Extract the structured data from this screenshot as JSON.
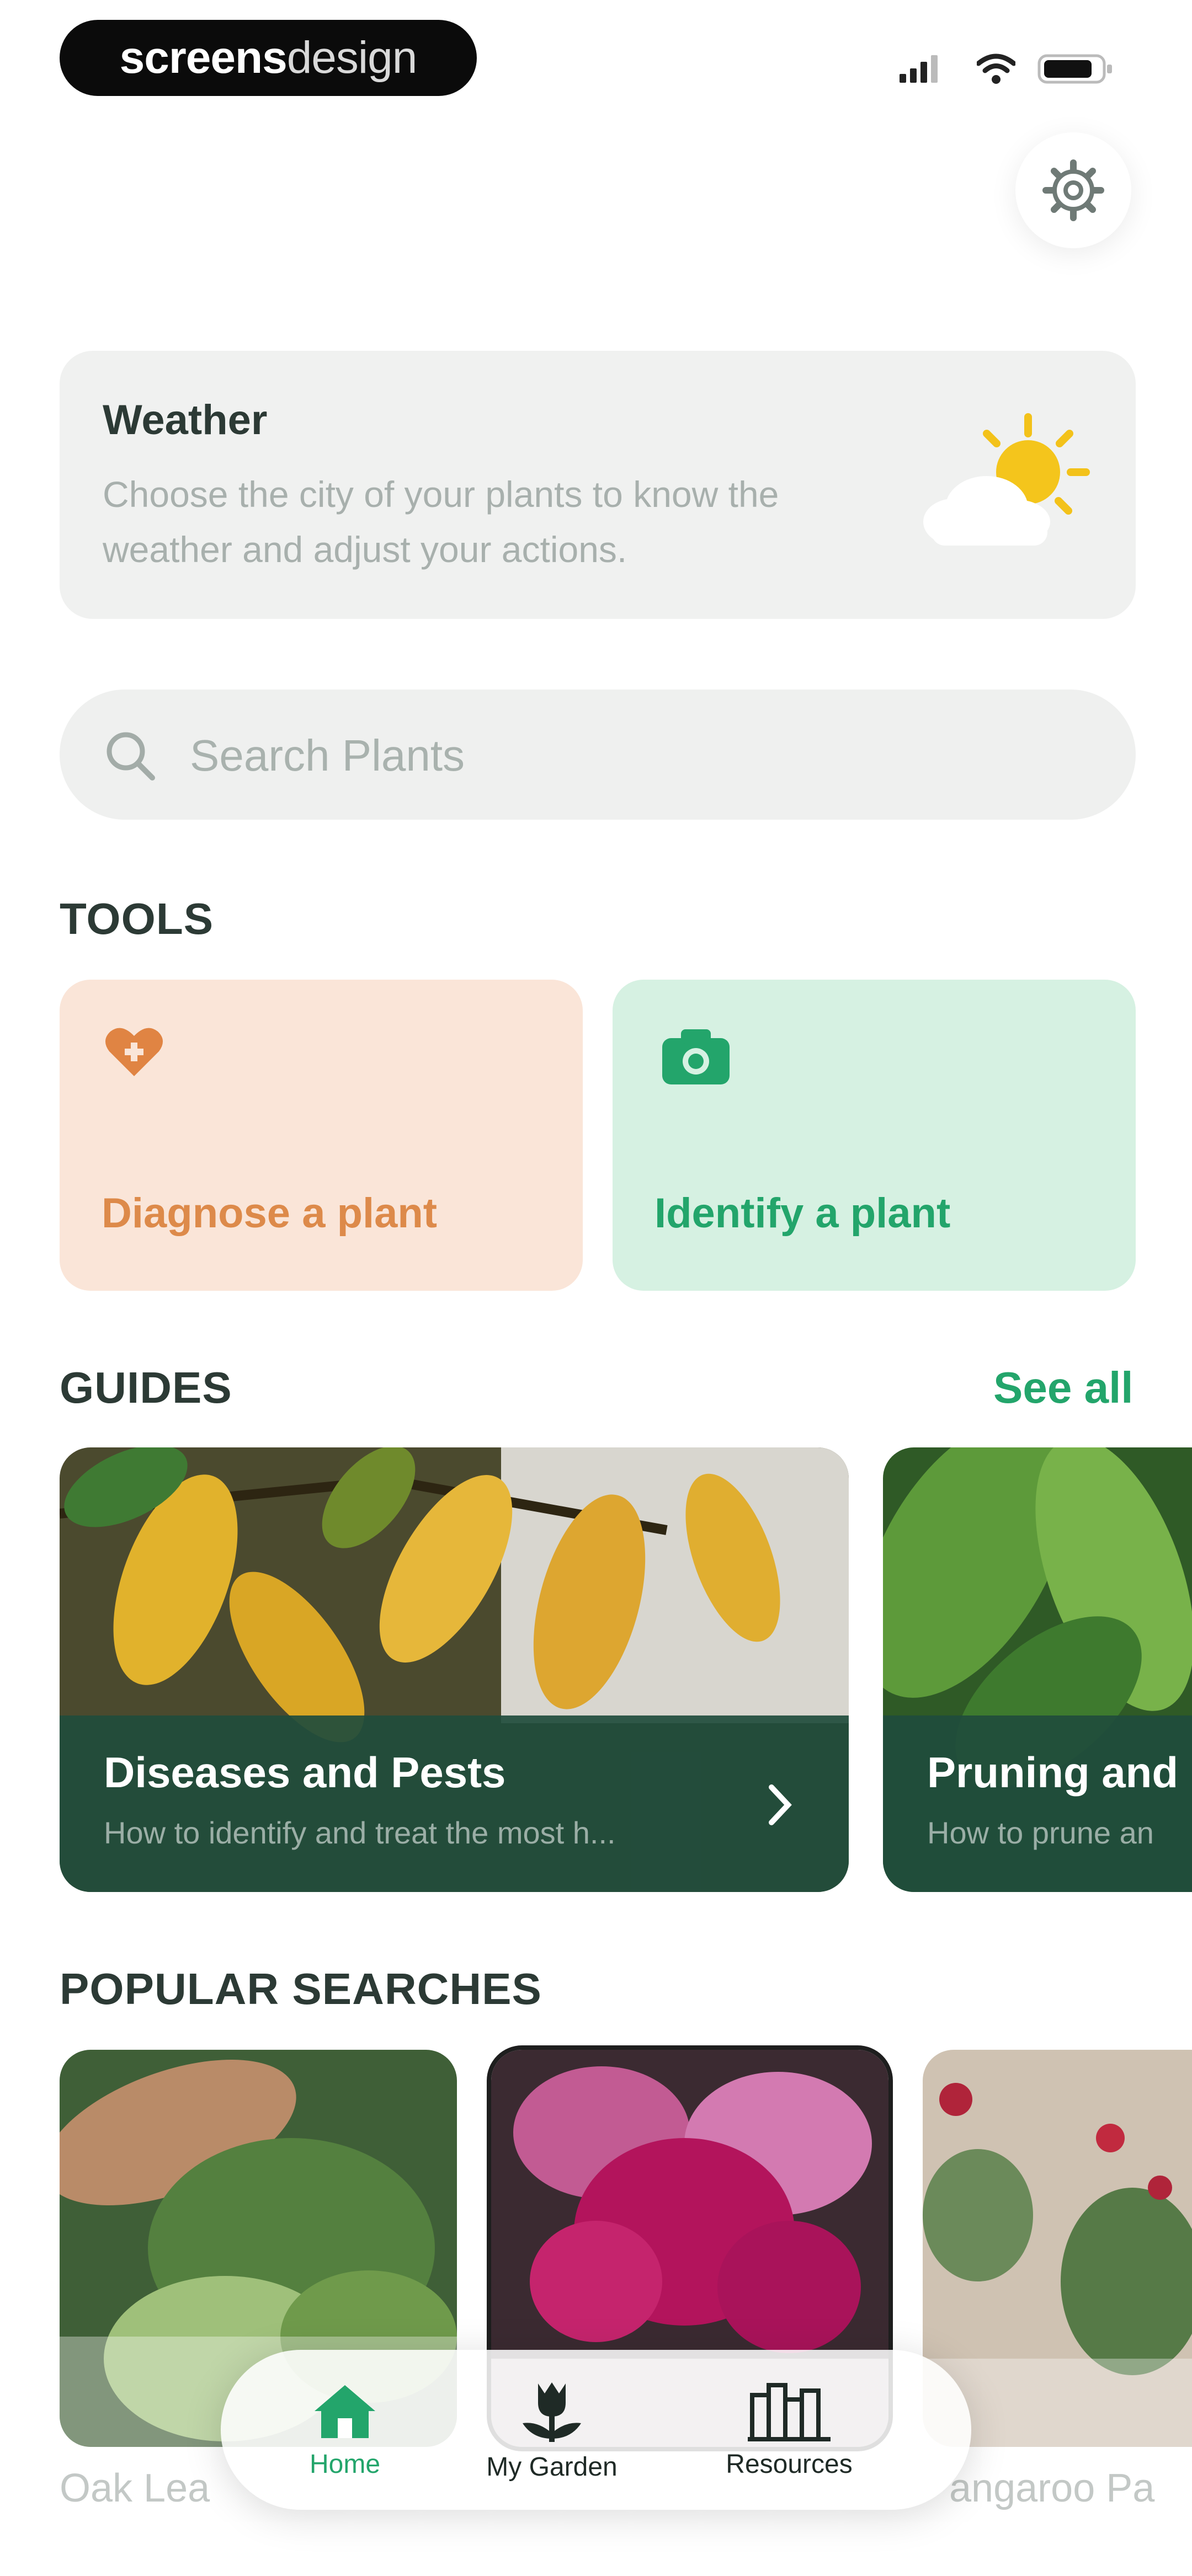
{
  "status_bar": {
    "brand_bold": "screens",
    "brand_light": "design",
    "icons": [
      "signal-icon",
      "wifi-icon",
      "battery-icon"
    ]
  },
  "header": {
    "settings_icon": "gear-icon"
  },
  "weather": {
    "title": "Weather",
    "description": "Choose the city of your plants to know the weather and adjust your actions.",
    "icon": "sun-cloud-icon"
  },
  "search": {
    "placeholder": "Search Plants",
    "icon": "search-icon"
  },
  "tools": {
    "title": "TOOLS",
    "items": [
      {
        "label": "Diagnose a plant",
        "icon": "heart-plus-icon",
        "bg": "#fae5d8",
        "fg": "#dd8a4a"
      },
      {
        "label": "Identify a plant",
        "icon": "camera-icon",
        "bg": "#d6f1e2",
        "fg": "#24a76b"
      }
    ]
  },
  "guides": {
    "title": "GUIDES",
    "see_all": "See all",
    "items": [
      {
        "title": "Diseases and Pests",
        "subtitle": "How to identify and treat the most h..."
      },
      {
        "title": "Pruning and",
        "subtitle": "How to prune an"
      }
    ]
  },
  "popular": {
    "title": "POPULAR SEARCHES",
    "items": [
      {
        "label": "Oak Lea"
      },
      {
        "label": ""
      },
      {
        "label": "angaroo Pa"
      }
    ]
  },
  "tabbar": {
    "items": [
      {
        "label": "Home",
        "icon": "home-icon",
        "active": true
      },
      {
        "label": "My Garden",
        "icon": "plant-icon",
        "active": false
      },
      {
        "label": "Resources",
        "icon": "books-icon",
        "active": false
      }
    ]
  },
  "colors": {
    "accent": "#23a56b",
    "heading": "#2c3a35"
  }
}
